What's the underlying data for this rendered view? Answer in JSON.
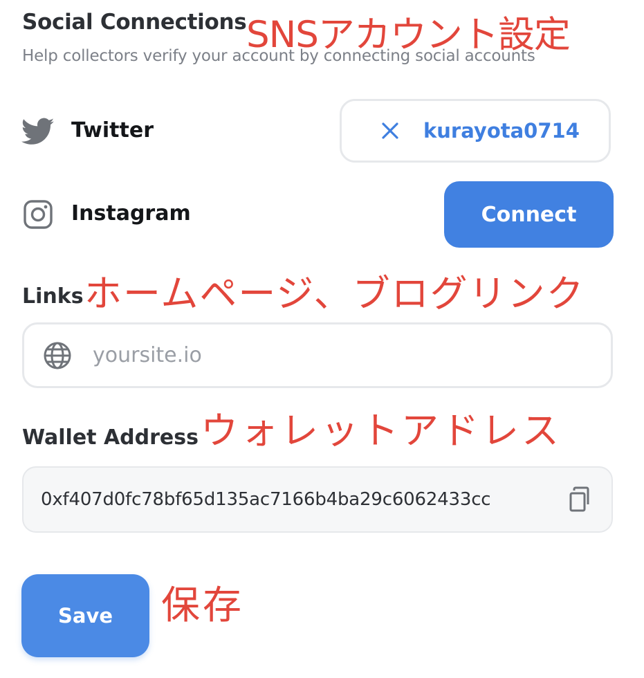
{
  "social_connections": {
    "title": "Social Connections",
    "subtitle": "Help collectors verify your account by connecting social accounts",
    "annotation": "SNSアカウント設定",
    "twitter": {
      "label": "Twitter",
      "icon": "twitter-bird-icon",
      "connected_handle": "kurayota0714",
      "disconnect_icon": "close-icon"
    },
    "instagram": {
      "label": "Instagram",
      "icon": "instagram-icon",
      "connect_label": "Connect"
    }
  },
  "links": {
    "label": "Links",
    "annotation": "ホームページ、ブログリンク",
    "icon": "globe-icon",
    "placeholder": "yoursite.io",
    "value": ""
  },
  "wallet": {
    "label": "Wallet Address",
    "annotation": "ウォレットアドレス",
    "address": "0xf407d0fc78bf65d135ac7166b4ba29c6062433cc",
    "copy_icon": "copy-icon"
  },
  "save": {
    "label": "Save",
    "annotation": "保存"
  },
  "colors": {
    "accent": "#4181e1",
    "annotation": "#e2463b",
    "label": "#2d3035",
    "muted": "#7c8088",
    "border": "#e6e8eb"
  }
}
